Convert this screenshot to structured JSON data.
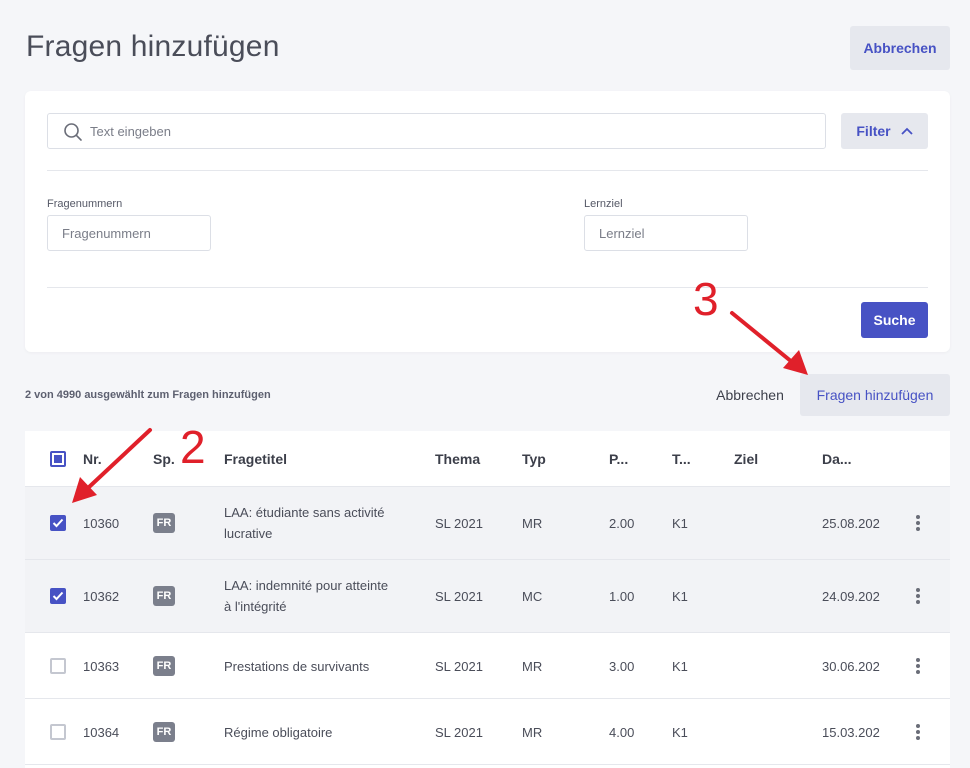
{
  "page": {
    "title": "Fragen hinzufügen",
    "cancel_label": "Abbrechen"
  },
  "search": {
    "placeholder": "Text eingeben",
    "filter_label": "Filter",
    "fields": [
      {
        "label": "Fragenummern",
        "placeholder": "Fragenummern"
      },
      {
        "label": "Lernziel",
        "placeholder": "Lernziel"
      }
    ],
    "search_label": "Suche"
  },
  "actions": {
    "selection_status": "2 von 4990 ausgewählt zum Fragen hinzufügen",
    "cancel_label": "Abbrechen",
    "add_label": "Fragen hinzufügen"
  },
  "table": {
    "headers": [
      "Nr.",
      "Sp.",
      "Fragetitel",
      "Thema",
      "Typ",
      "P...",
      "T...",
      "Ziel",
      "Da..."
    ],
    "rows": [
      {
        "checked": true,
        "nr": "10360",
        "lang": "FR",
        "title_line1": "LAA: étudiante sans activité",
        "title_line2": "lucrative",
        "thema": "SL 2021",
        "typ": "MR",
        "points": "2.00",
        "t": "K1",
        "ziel": "",
        "date": "25.08.202"
      },
      {
        "checked": true,
        "nr": "10362",
        "lang": "FR",
        "title_line1": "LAA: indemnité pour atteinte",
        "title_line2": "à l'intégrité",
        "thema": "SL 2021",
        "typ": "MC",
        "points": "1.00",
        "t": "K1",
        "ziel": "",
        "date": "24.09.202"
      },
      {
        "checked": false,
        "nr": "10363",
        "lang": "FR",
        "title_line1": "Prestations de survivants",
        "title_line2": "",
        "thema": "SL 2021",
        "typ": "MR",
        "points": "3.00",
        "t": "K1",
        "ziel": "",
        "date": "30.06.202"
      },
      {
        "checked": false,
        "nr": "10364",
        "lang": "FR",
        "title_line1": "Régime obligatoire",
        "title_line2": "",
        "thema": "SL 2021",
        "typ": "MR",
        "points": "4.00",
        "t": "K1",
        "ziel": "",
        "date": "15.03.202"
      }
    ]
  },
  "annotations": {
    "step2": "2",
    "step3": "3",
    "color": "#e0202a"
  },
  "colors": {
    "accent": "#4752c4",
    "background": "#f5f6f9",
    "badge": "#7b7f8c"
  }
}
